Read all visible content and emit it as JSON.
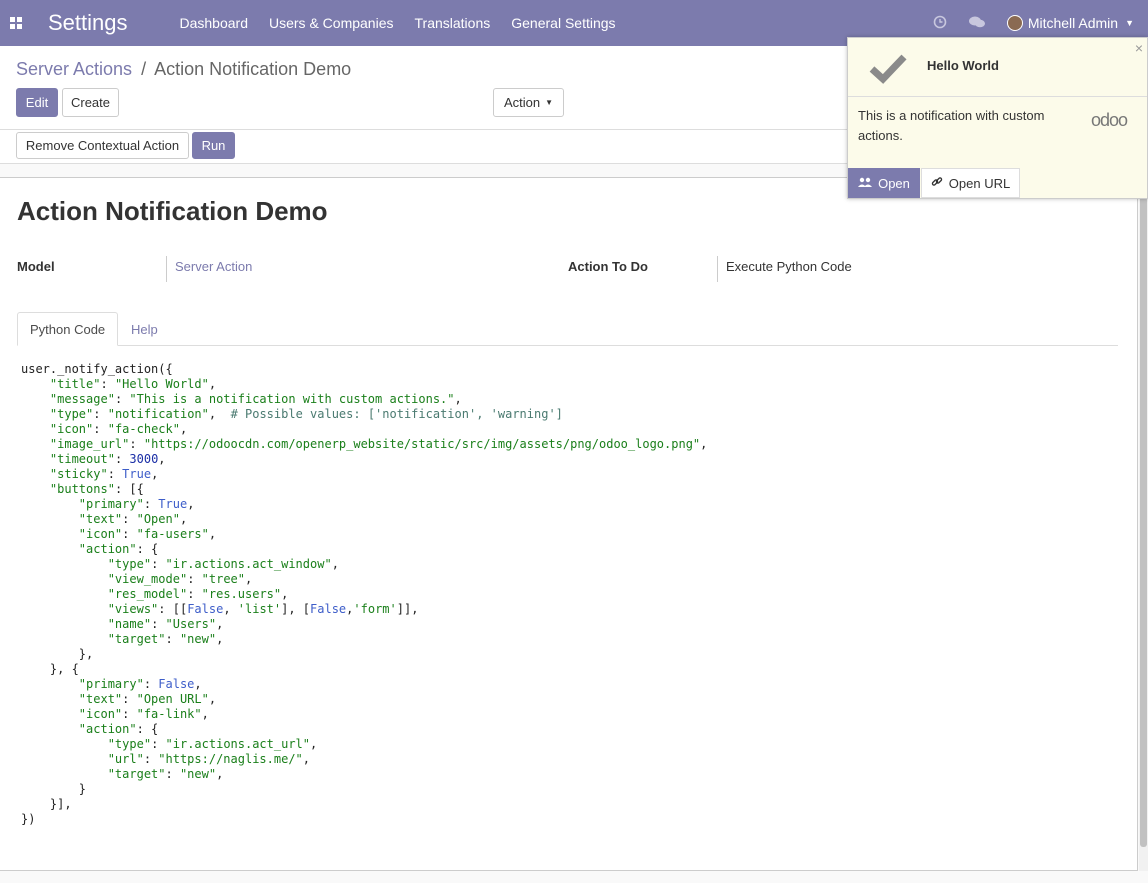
{
  "navbar": {
    "app_title": "Settings",
    "menu": [
      "Dashboard",
      "Users & Companies",
      "Translations",
      "General Settings"
    ],
    "user_name": "Mitchell Admin"
  },
  "control_panel": {
    "breadcrumb_parent": "Server Actions",
    "breadcrumb_sep": "/",
    "breadcrumb_current": "Action Notification Demo",
    "edit_label": "Edit",
    "create_label": "Create",
    "action_label": "Action",
    "remove_contextual_label": "Remove Contextual Action",
    "run_label": "Run"
  },
  "form": {
    "title": "Action Notification Demo",
    "model_label": "Model",
    "model_value": "Server Action",
    "action_to_do_label": "Action To Do",
    "action_to_do_value": "Execute Python Code",
    "tabs": [
      "Python Code",
      "Help"
    ],
    "code_lines": [
      "user._notify_action({",
      "    \"title\": \"Hello World\",",
      "    \"message\": \"This is a notification with custom actions.\",",
      "    \"type\": \"notification\",  # Possible values: ['notification', 'warning']",
      "    \"icon\": \"fa-check\",",
      "    \"image_url\": \"https://odoocdn.com/openerp_website/static/src/img/assets/png/odoo_logo.png\",",
      "    \"timeout\": 3000,",
      "    \"sticky\": True,",
      "    \"buttons\": [{",
      "        \"primary\": True,",
      "        \"text\": \"Open\",",
      "        \"icon\": \"fa-users\",",
      "        \"action\": {",
      "            \"type\": \"ir.actions.act_window\",",
      "            \"view_mode\": \"tree\",",
      "            \"res_model\": \"res.users\",",
      "            \"views\": [[False, 'list'], [False,'form']],",
      "            \"name\": \"Users\",",
      "            \"target\": \"new\",",
      "        },",
      "    }, {",
      "        \"primary\": False,",
      "        \"text\": \"Open URL\",",
      "        \"icon\": \"fa-link\",",
      "        \"action\": {",
      "            \"type\": \"ir.actions.act_url\",",
      "            \"url\": \"https://naglis.me/\",",
      "            \"target\": \"new\",",
      "        }",
      "    }],",
      "})"
    ]
  },
  "notification": {
    "close_glyph": "×",
    "title": "Hello World",
    "message": "This is a notification with custom actions.",
    "logo_text": "odoo",
    "open_label": "Open",
    "open_url_label": "Open URL"
  },
  "colors": {
    "brand": "#7c7bad",
    "notification_bg": "#fcfbea"
  }
}
